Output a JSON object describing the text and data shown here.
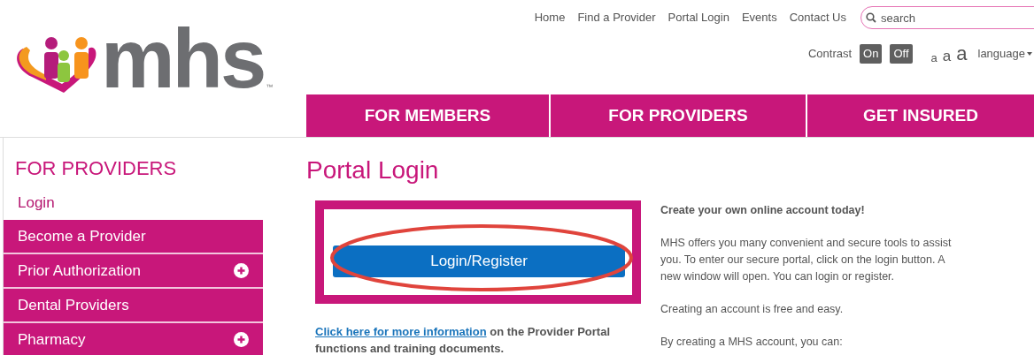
{
  "logo": {
    "wordmark": "mhs",
    "trademark": "™"
  },
  "top_links": [
    "Home",
    "Find a Provider",
    "Portal Login",
    "Events",
    "Contact Us"
  ],
  "search": {
    "placeholder": "search"
  },
  "contrast": {
    "label": "Contrast",
    "options": [
      "On",
      "Off"
    ]
  },
  "text_sizes": [
    "a",
    "a",
    "a"
  ],
  "language": "language",
  "main_nav": [
    "FOR MEMBERS",
    "FOR PROVIDERS",
    "GET INSURED"
  ],
  "sidebar": {
    "title": "FOR PROVIDERS",
    "items": [
      {
        "label": "Login",
        "selected": true,
        "expandable": false
      },
      {
        "label": "Become a Provider",
        "selected": false,
        "expandable": false
      },
      {
        "label": "Prior Authorization",
        "selected": false,
        "expandable": true
      },
      {
        "label": "Dental Providers",
        "selected": false,
        "expandable": false
      },
      {
        "label": "Pharmacy",
        "selected": false,
        "expandable": true
      }
    ]
  },
  "page": {
    "title": "Portal Login",
    "login_button": "Login/Register",
    "info_link": "Click here for more information",
    "info_text": " on the Provider Portal functions and training documents.",
    "aside": {
      "heading": "Create your own online account today!",
      "paragraphs": [
        "MHS offers you many convenient and secure tools to assist you. To enter our secure portal, click on the login button. A new window will open. You can login or register.",
        "Creating an account is free and easy.",
        "By creating a MHS account, you can:"
      ]
    }
  }
}
